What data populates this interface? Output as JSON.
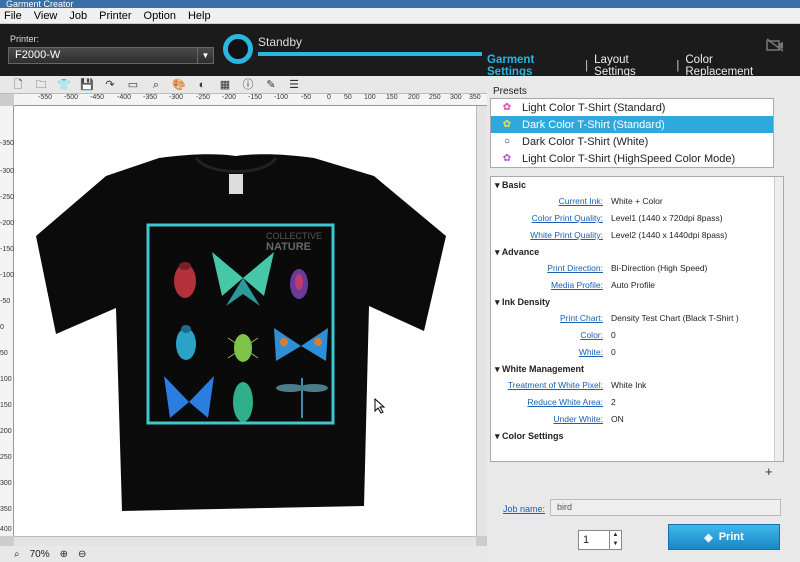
{
  "titlebar": {
    "title": "Garment Creator"
  },
  "menu": [
    "File",
    "View",
    "Job",
    "Printer",
    "Option",
    "Help"
  ],
  "printer": {
    "label": "Printer:",
    "value": "F2000-W"
  },
  "status": {
    "text": "Standby"
  },
  "tabs": {
    "garment": "Garment Settings",
    "layout": "Layout Settings",
    "color": "Color Replacement"
  },
  "toolbar_icons": [
    "new-icon",
    "open-icon",
    "shirt-icon",
    "save-icon",
    "redo-icon",
    "frame-icon",
    "search-tool-icon",
    "palette-icon",
    "white-ink-icon",
    "calculator-icon",
    "info-icon",
    "notes-icon",
    "list-icon"
  ],
  "ruler_h": [
    "-550",
    "-500",
    "-450",
    "-400",
    "-350",
    "-300",
    "-250",
    "-200",
    "-150",
    "-100",
    "-50",
    "0",
    "50",
    "100",
    "150",
    "200",
    "250",
    "300",
    "350"
  ],
  "ruler_v": [
    "-350",
    "-300",
    "-250",
    "-200",
    "-150",
    "-100",
    "-50",
    "0",
    "50",
    "100",
    "150",
    "200",
    "250",
    "300",
    "350",
    "400"
  ],
  "artwork": {
    "brand_line1": "COLLECTIVE",
    "brand_line2": "NATURE"
  },
  "zoom": {
    "value": "70%"
  },
  "presets": {
    "title": "Presets",
    "items": [
      {
        "label": "Light Color T-Shirt (Standard)",
        "icon": "light-shirt-icon"
      },
      {
        "label": "Dark Color T-Shirt (Standard)",
        "icon": "dark-shirt-icon"
      },
      {
        "label": "Dark Color T-Shirt (White)",
        "icon": "white-circle-icon"
      },
      {
        "label": "Light Color T-Shirt (HighSpeed Color Mode)",
        "icon": "highspeed-icon"
      }
    ]
  },
  "settings": {
    "basic": {
      "title": "Basic",
      "current_ink_label": "Current Ink:",
      "current_ink": "White + Color",
      "color_quality_label": "Color Print Quality:",
      "color_quality": "Level1 (1440 x 720dpi 8pass)",
      "white_quality_label": "White Print Quality:",
      "white_quality": "Level2 (1440 x 1440dpi 8pass)"
    },
    "advance": {
      "title": "Advance",
      "direction_label": "Print Direction:",
      "direction": "Bi-Direction (High Speed)",
      "media_label": "Media Profile:",
      "media": "Auto Profile"
    },
    "ink_density": {
      "title": "Ink Density",
      "chart_label": "Print Chart:",
      "chart": "Density Test Chart (Black T-Shirt )",
      "color_label": "Color:",
      "color": "0",
      "white_label": "White:",
      "white": "0"
    },
    "white_mgmt": {
      "title": "White Management",
      "treatment_label": "Treatment of White Pixel:",
      "treatment": "White Ink",
      "reduce_label": "Reduce White Area:",
      "reduce": "2",
      "under_label": "Under White:",
      "under": "ON"
    },
    "color_settings": {
      "title": "Color Settings"
    }
  },
  "job": {
    "label": "Job name:",
    "value": "bird"
  },
  "copies": {
    "value": "1"
  },
  "print_button": {
    "label": "Print"
  },
  "colors": {
    "accent": "#2cb5e0",
    "selected": "#2ea9de",
    "shirt": "#0b0b0b"
  }
}
